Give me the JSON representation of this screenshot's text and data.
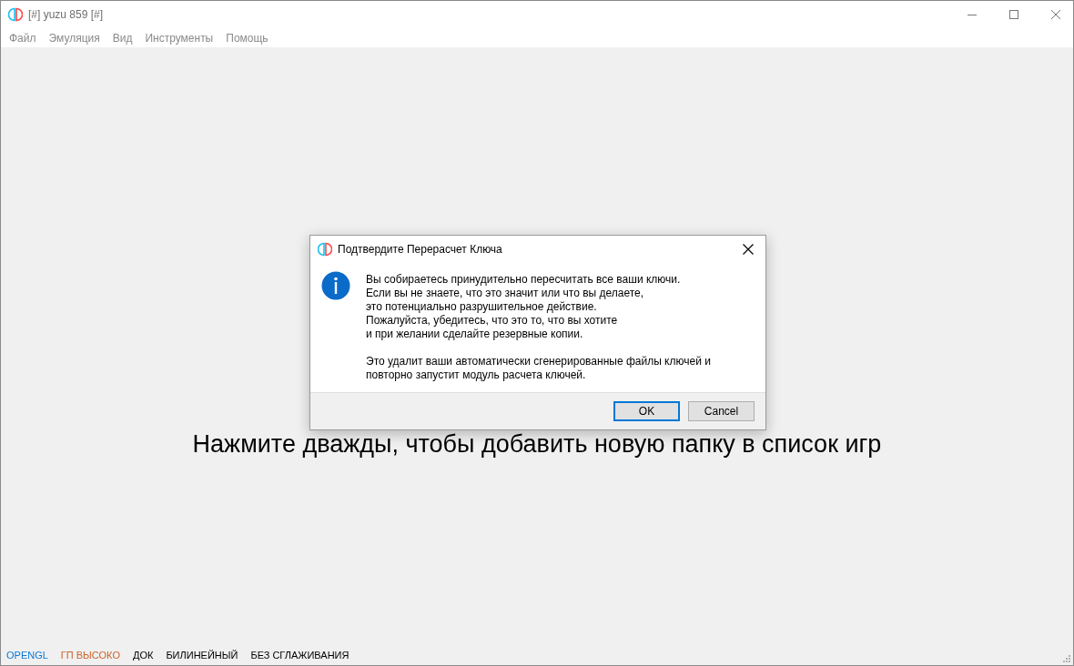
{
  "window": {
    "title": "[#] yuzu 859 [#]"
  },
  "menu": [
    "Файл",
    "Эмуляция",
    "Вид",
    "Инструменты",
    "Помощь"
  ],
  "game_list": {
    "hint": "Нажмите дважды, чтобы добавить новую папку в список игр"
  },
  "dialog": {
    "title": "Подтвердите Перерасчет Ключа",
    "paragraphs": [
      "Вы собираетесь принудительно пересчитать все ваши ключи.\nЕсли вы не знаете, что это значит или что вы делаете,\nэто потенциально разрушительное действие.\nПожалуйста, убедитесь, что это то, что вы хотите\nи при желании сделайте резервные копии.",
      "Это удалит ваши автоматически сгенерированные файлы ключей и\nповторно запустит модуль расчета ключей."
    ],
    "buttons": [
      {
        "label": "OK",
        "default": true
      },
      {
        "label": "Cancel",
        "default": false
      }
    ]
  },
  "status_bar": [
    {
      "label": "OPENGL",
      "color": "#0a78d7"
    },
    {
      "label": "ГП ВЫСОКО",
      "color": "#c8642d"
    },
    {
      "label": "ДОК",
      "color": "#000000"
    },
    {
      "label": "БИЛИНЕЙНЫЙ",
      "color": "#000000"
    },
    {
      "label": "БЕЗ СГЛАЖИВАНИЯ",
      "color": "#000000"
    }
  ]
}
